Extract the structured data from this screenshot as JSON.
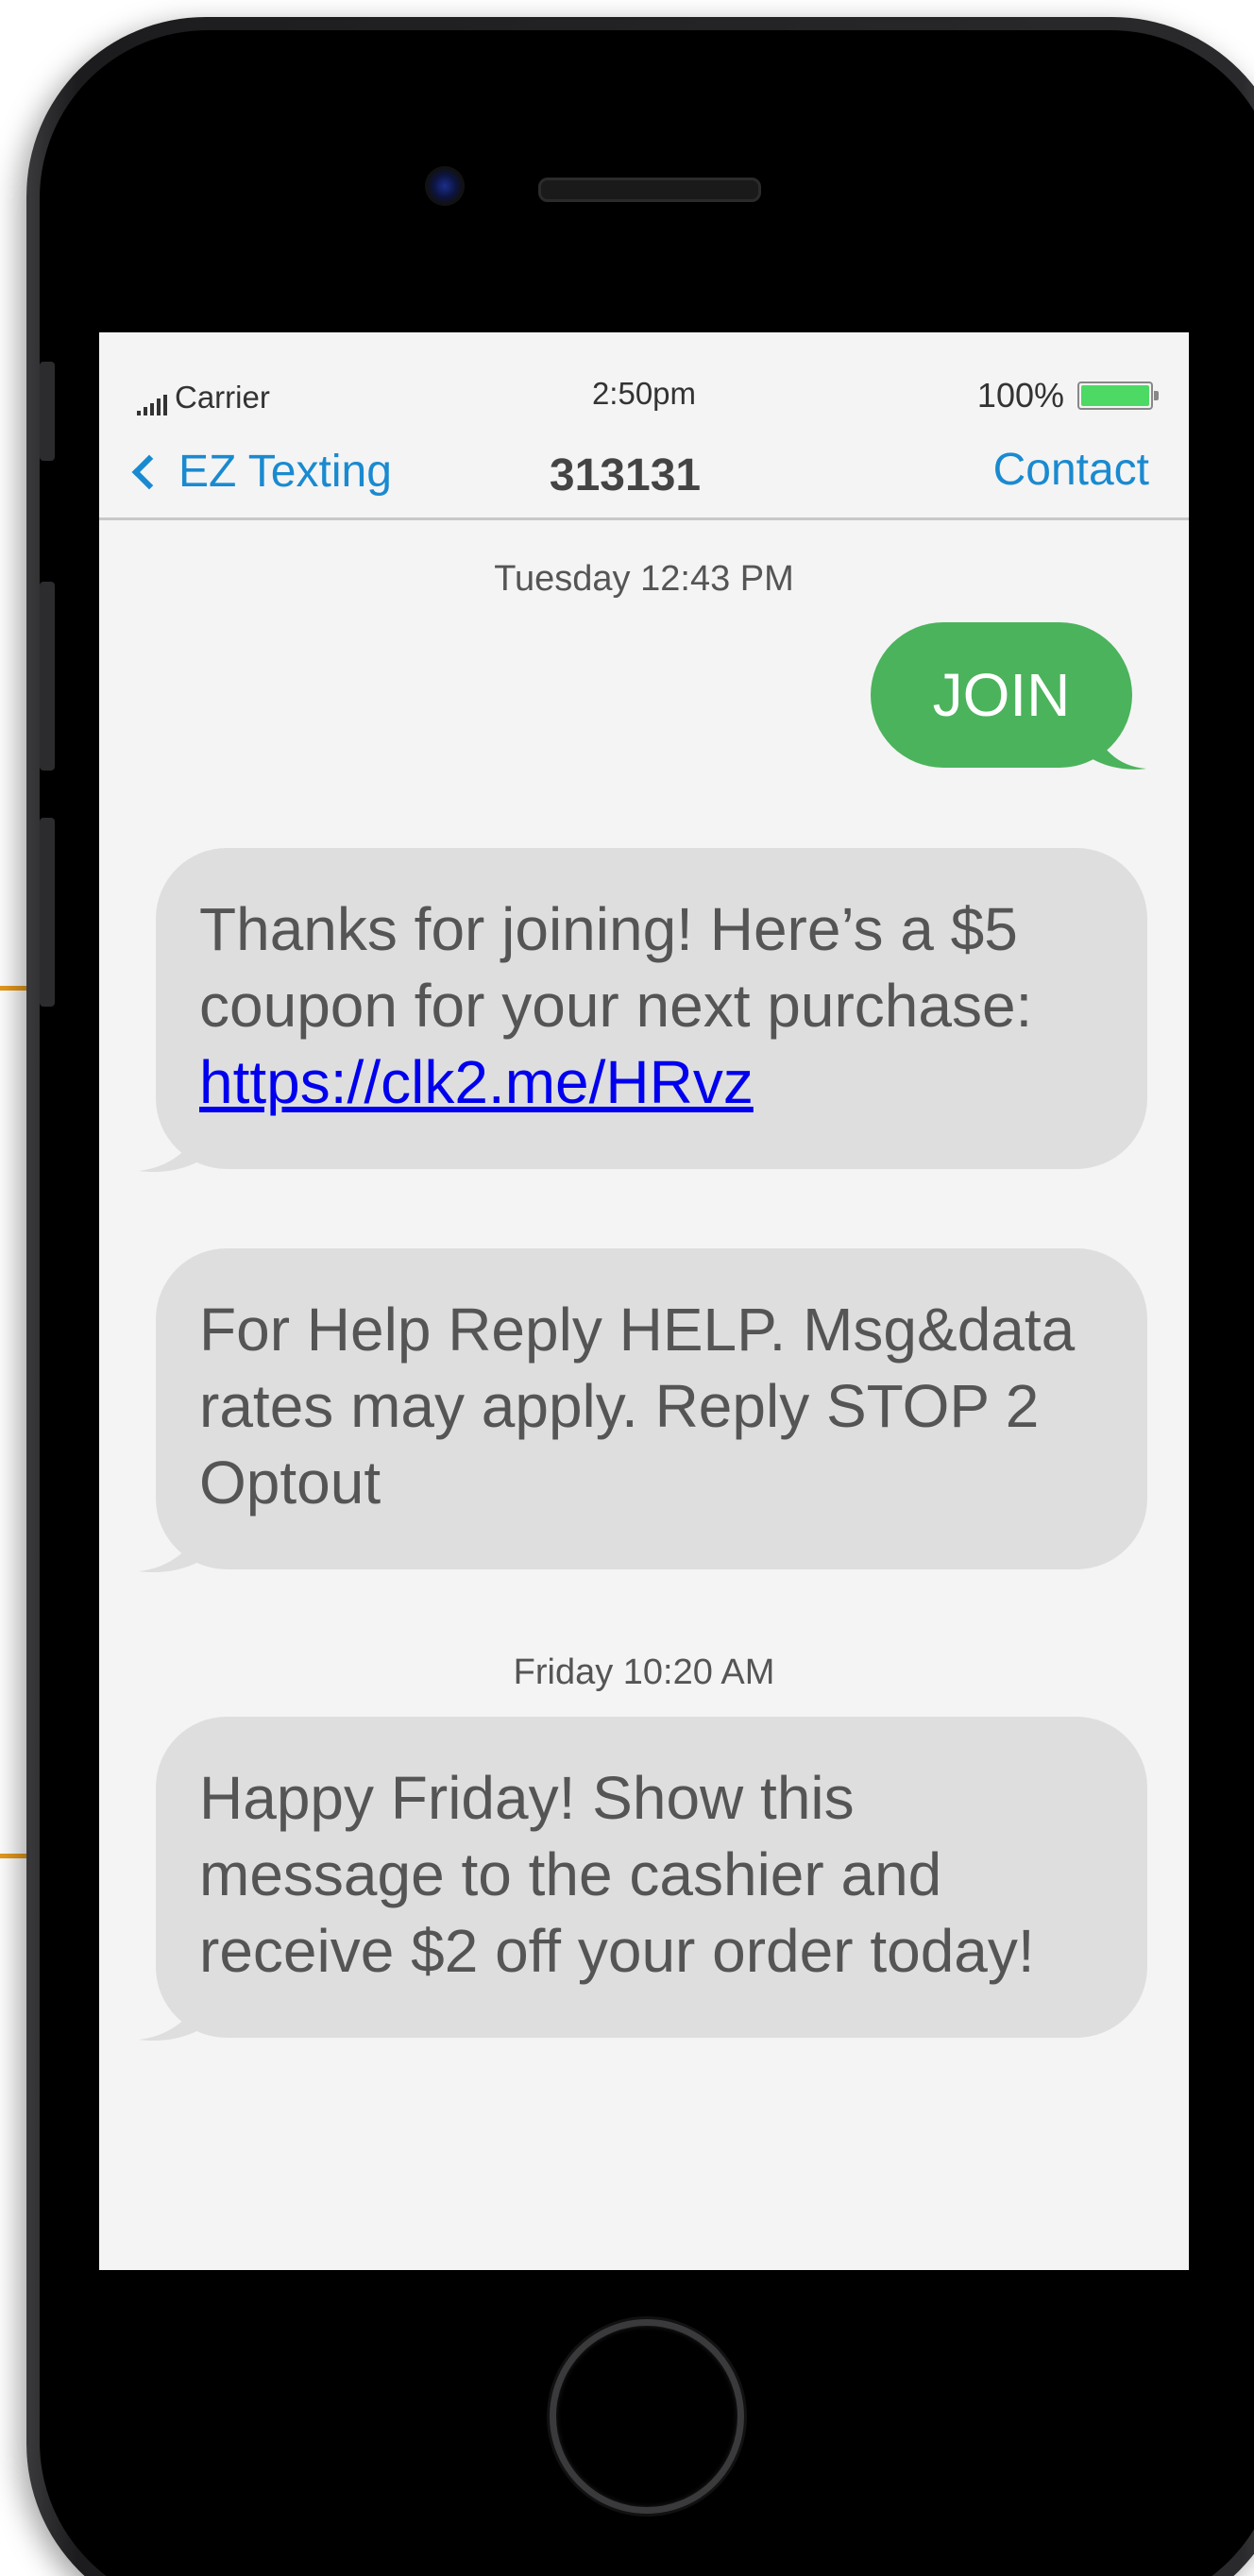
{
  "status_bar": {
    "carrier": "Carrier",
    "time": "2:50pm",
    "battery": "100%"
  },
  "nav": {
    "back_label": "EZ Texting",
    "title": "313131",
    "contact_label": "Contact"
  },
  "messages": [
    {
      "type": "timestamp",
      "text": "Tuesday 12:43 PM"
    },
    {
      "type": "outgoing",
      "text": "JOIN"
    },
    {
      "type": "incoming",
      "text": "Thanks for joining! Here’s a $5 coupon for your next purchase: ",
      "link": "https://clk2.me/HRvz"
    },
    {
      "type": "incoming",
      "text": "For Help Reply HELP. Msg&data rates may apply. Reply STOP 2 Optout"
    },
    {
      "type": "timestamp",
      "text": "Friday 10:20 AM"
    },
    {
      "type": "incoming",
      "text": "Happy Friday! Show this message to the cashier and receive $2 off your order today!"
    }
  ],
  "colors": {
    "outgoing_bubble": "#4bb35c",
    "incoming_bubble": "#dedede",
    "accent": "#1a8ad0",
    "link": "#0000ee",
    "battery": "#4cd964"
  }
}
